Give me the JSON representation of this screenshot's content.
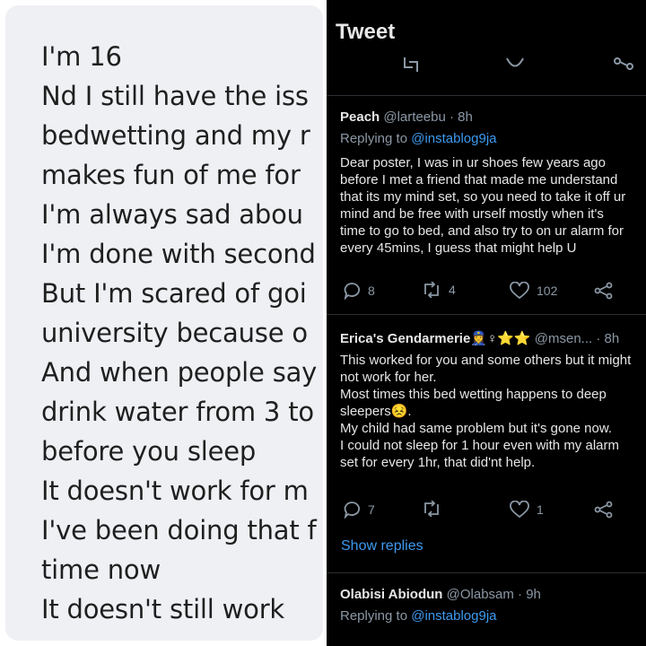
{
  "note": {
    "lines": [
      "I'm 16",
      "Nd I still have the iss",
      "bedwetting and my r",
      "makes fun of me for",
      "I'm always sad abou",
      "I'm done with second",
      "But I'm scared of goi",
      "university because o",
      "And when people say",
      "drink water from 3 to",
      "before you sleep",
      "It doesn't work for m",
      "I've been doing that f",
      "time now",
      "It doesn't still work"
    ]
  },
  "thread": {
    "header_title": "Tweet",
    "tweets": [
      {
        "name": "Peach",
        "handle": "@larteebu",
        "time": "· 8h",
        "replying_label": "Replying to",
        "replying_to": "@instablog9ja",
        "body_lines": [
          "Dear poster, I was in ur shoes few years ago",
          "before I met a friend that made me understand",
          "that its my mind set, so you need to take it off ur",
          "mind and be free with urself mostly when it's",
          "time to go to bed, and also try to on ur alarm for",
          "every 45mins, I guess that might help U"
        ],
        "replies": "8",
        "retweets": "4",
        "likes": "102"
      },
      {
        "name": "Erica's Gendarmerie👮‍♀️♀⭐⭐",
        "handle": "@msen...",
        "time": "· 8h",
        "body_lines": [
          "This worked for you and some others but it might",
          "not work for her.",
          "Most times this bed wetting happens to deep",
          "sleepers😣.",
          "My child had same problem but it's gone now.",
          "I could not sleep for 1 hour even with my alarm",
          "set for every 1hr, that did'nt help."
        ],
        "replies": "7",
        "retweets": "",
        "likes": "1",
        "show_replies": "Show replies"
      },
      {
        "name": "Olabisi Abiodun",
        "handle": "@Olabsam",
        "time": "· 9h",
        "replying_label": "Replying to",
        "replying_to": "@instablog9ja"
      }
    ]
  },
  "colors": {
    "accent": "#3d9af0",
    "muted": "#8b98a5",
    "background": "#000000"
  }
}
